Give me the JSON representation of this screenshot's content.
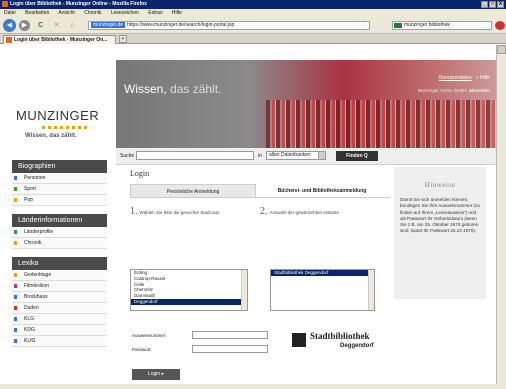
{
  "window": {
    "title": "Login über Bibliothek - Munzinger Online - Mozilla Firefox",
    "min": "_",
    "max": "□",
    "close": "X"
  },
  "menu": [
    "Datei",
    "Bearbeiten",
    "Ansicht",
    "Chronik",
    "Lesezeichen",
    "Extras",
    "Hilfe"
  ],
  "nav": {
    "back": "◀",
    "forward": "▶",
    "reload": "C",
    "stop": "✕",
    "home": "⌂",
    "url_highlight": "munzinger.de",
    "url": "https://www.munzinger.de/search/login-portal.jsp",
    "search_value": "munzinger bibliothek",
    "star": "☆"
  },
  "tab": {
    "label": "Login über Bibliothek - Munzinger On...",
    "new": "+"
  },
  "logo": {
    "name": "MUNZINGER",
    "tagline": "Wissen, das zählt."
  },
  "hero": {
    "title_main": "Wissen,",
    "title_light": " das zählt.",
    "link1": "Benutzerdaten",
    "link2": "» Hilfe",
    "user": "Munzinger Archiv GmbH",
    "logout": "abmelden"
  },
  "search": {
    "label": "Suche",
    "in": "in",
    "scope": "allen Datenbanken",
    "button": "Finden Q"
  },
  "sidebar": [
    {
      "title": "Biographien",
      "items": [
        {
          "label": "Personen",
          "color": "#3a6fd8"
        },
        {
          "label": "Sport",
          "color": "#3a9a3a"
        },
        {
          "label": "Pop",
          "color": "#e6a21a"
        }
      ]
    },
    {
      "title": "Länderinformationen",
      "items": [
        {
          "label": "Länderprofile",
          "color": "#3a9a3a"
        },
        {
          "label": "Chronik",
          "color": "#e6a21a"
        }
      ]
    },
    {
      "title": "Lexika",
      "items": [
        {
          "label": "Gedenktage",
          "color": "#e6a21a"
        },
        {
          "label": "Filmlexikon",
          "color": "#c0307a"
        },
        {
          "label": "Brockhaus",
          "color": "#3a6fd8"
        },
        {
          "label": "Duden",
          "color": "#c03030"
        },
        {
          "label": "KLG",
          "color": "#3a6fd8"
        },
        {
          "label": "KDG",
          "color": "#3a6fd8"
        },
        {
          "label": "KLfG",
          "color": "#3a6fd8"
        }
      ]
    }
  ],
  "main": {
    "title": "Login",
    "tab_personal": "Persönliche Anmeldung",
    "tab_library": "Bücherei- und Bibliotheksanmeldung",
    "step1_num": "1.",
    "step1_text": "Wählen Sie bitte die gesuchte Stadt aus",
    "step2_num": "2.",
    "step2_text": "Auswahl der gewünschten Institute",
    "cities": [
      "Erding",
      "Castrop-Rauxel",
      "Celle",
      "Chemnitz",
      "Darmstadt",
      "Deggendorf"
    ],
    "city_selected": "Deggendorf",
    "institute_selected": "Stadtbibliothek Deggendorf",
    "user_label": "Ausweisnummer:",
    "pass_label": "Passwort:",
    "login_button": "Login ▸",
    "lib_name": "Stadtbibliothek",
    "lib_city": "Deggendorf"
  },
  "hinweise": {
    "title": "Hinweise",
    "text": "Damit Sie sich anmelden können, benötigen Sie Ihre Ausweisnummer (zu finden auf Ihrem „Leserausweis“) und als Passwort Ihr Geburtsdatum (wenn Sie z.B. am 25. Oktober 1970 geboren sind, lautet Ihr Passwort 25.10.1970)."
  }
}
